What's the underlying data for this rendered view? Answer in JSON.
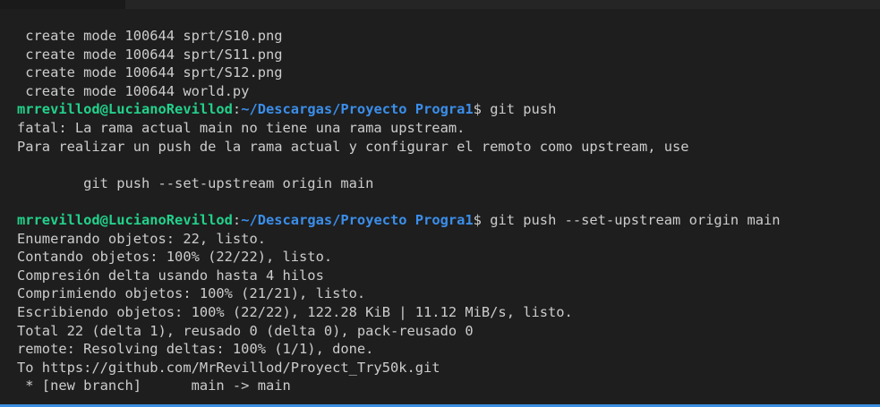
{
  "lines": [
    {
      "type": "text",
      "text": " create mode 100644 sprt/S10.png"
    },
    {
      "type": "text",
      "text": " create mode 100644 sprt/S11.png"
    },
    {
      "type": "text",
      "text": " create mode 100644 sprt/S12.png"
    },
    {
      "type": "text",
      "text": " create mode 100644 world.py"
    },
    {
      "type": "prompt",
      "user": "mrrevillod@LucianoRevillod",
      "colon": ":",
      "path": "~/Descargas/Proyecto Progra1",
      "symbol": "$ ",
      "command": "git push"
    },
    {
      "type": "text",
      "text": "fatal: La rama actual main no tiene una rama upstream."
    },
    {
      "type": "text",
      "text": "Para realizar un push de la rama actual y configurar el remoto como upstream, use"
    },
    {
      "type": "text",
      "text": ""
    },
    {
      "type": "text",
      "text": "        git push --set-upstream origin main"
    },
    {
      "type": "text",
      "text": ""
    },
    {
      "type": "prompt",
      "user": "mrrevillod@LucianoRevillod",
      "colon": ":",
      "path": "~/Descargas/Proyecto Progra1",
      "symbol": "$ ",
      "command": "git push --set-upstream origin main"
    },
    {
      "type": "text",
      "text": "Enumerando objetos: 22, listo."
    },
    {
      "type": "text",
      "text": "Contando objetos: 100% (22/22), listo."
    },
    {
      "type": "text",
      "text": "Compresión delta usando hasta 4 hilos"
    },
    {
      "type": "text",
      "text": "Comprimiendo objetos: 100% (21/21), listo."
    },
    {
      "type": "text",
      "text": "Escribiendo objetos: 100% (22/22), 122.28 KiB | 11.12 MiB/s, listo."
    },
    {
      "type": "text",
      "text": "Total 22 (delta 1), reusado 0 (delta 0), pack-reusado 0"
    },
    {
      "type": "text",
      "text": "remote: Resolving deltas: 100% (1/1), done."
    },
    {
      "type": "text",
      "text": "To https://github.com/MrRevillod/Proyect_Try50k.git"
    },
    {
      "type": "text",
      "text": " * [new branch]      main -> main"
    }
  ],
  "colors": {
    "background": "#1e1e1e",
    "text": "#cccccc",
    "user": "#23d18b",
    "path": "#3b8eea",
    "accent_bar": "#3c8ee0"
  }
}
